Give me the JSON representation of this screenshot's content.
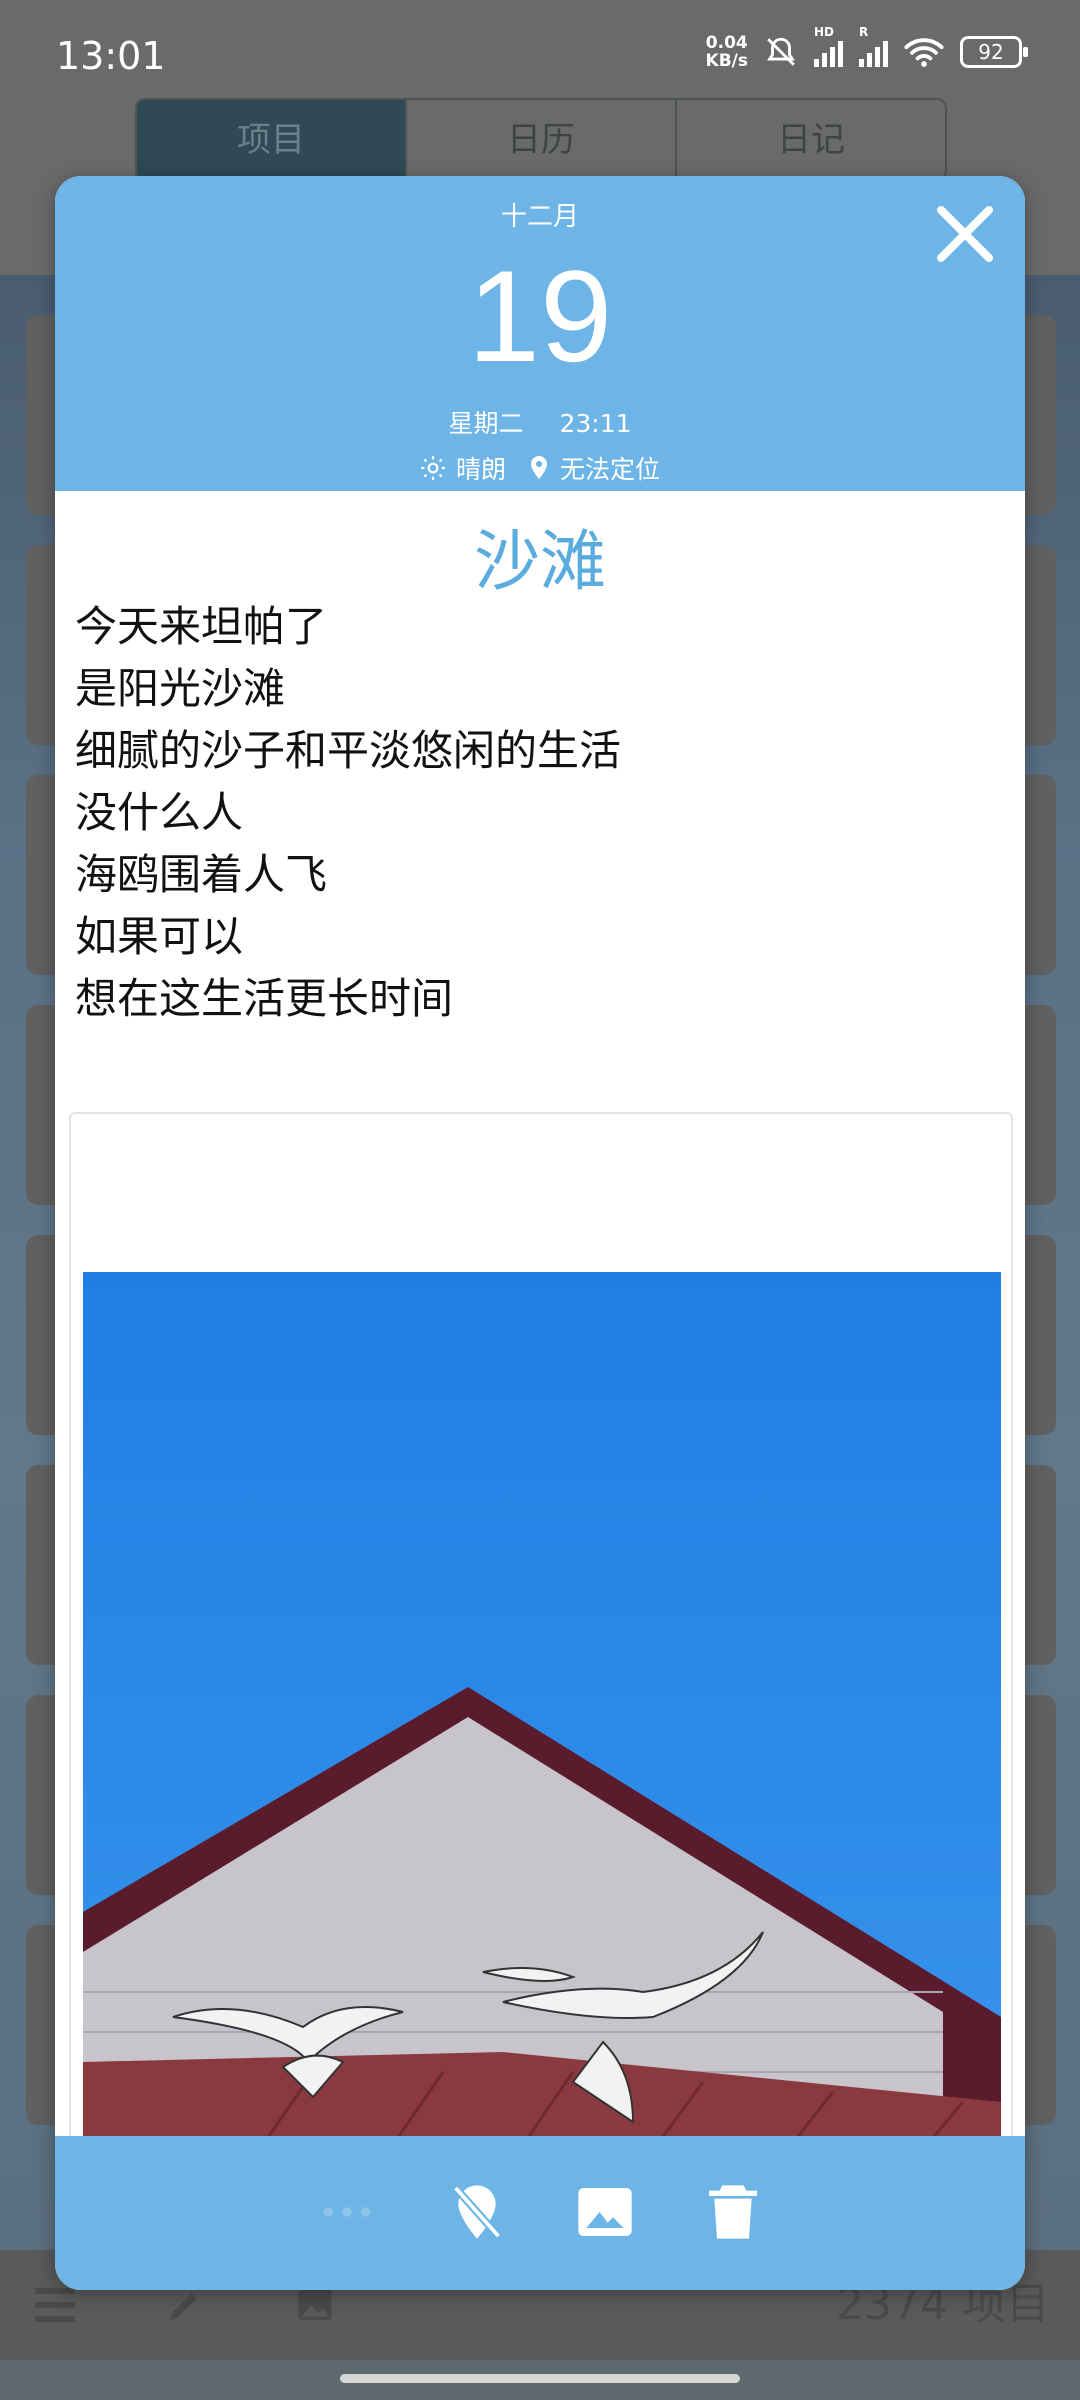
{
  "status_bar": {
    "time": "13:01",
    "net_speed_value": "0.04",
    "net_speed_unit": "KB/s",
    "sim1_label": "HD",
    "sim2_label": "R",
    "battery": "92"
  },
  "background_app": {
    "tabs": [
      {
        "label": "项目"
      },
      {
        "label": "日历"
      },
      {
        "label": "日记"
      }
    ],
    "count_label": "2374 项目"
  },
  "entry": {
    "month": "十二月",
    "day": "19",
    "weekday": "星期二",
    "time": "23:11",
    "weather": "晴朗",
    "location": "无法定位",
    "title": "沙滩",
    "body_lines": [
      "今天来坦帕了",
      "是阳光沙滩",
      "细腻的沙子和平淡悠闲的生活",
      "没什么人",
      "海鸥围着人飞",
      "如果可以",
      "想在这生活更长时间"
    ]
  },
  "colors": {
    "accent": "#6cb5e6",
    "title": "#5aacdf",
    "sky": "#2a8ae8"
  },
  "icons": {
    "close": "close-icon",
    "more": "more-dots-icon",
    "location_off": "location-off-icon",
    "image": "image-icon",
    "delete": "trash-icon"
  }
}
